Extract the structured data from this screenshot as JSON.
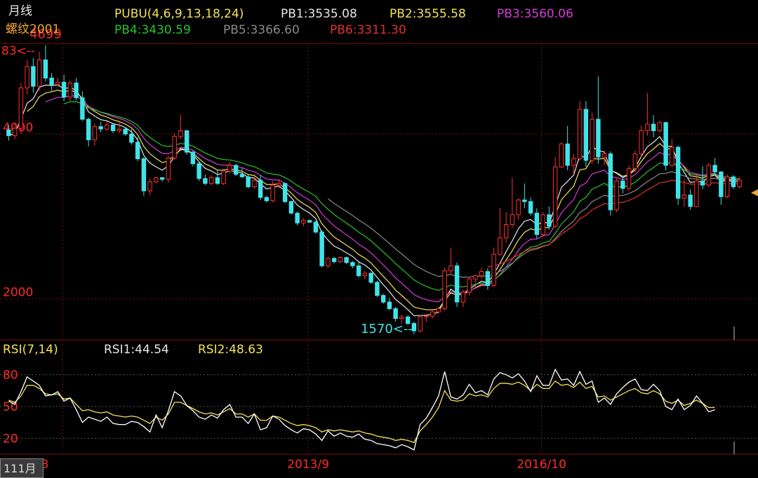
{
  "header": {
    "period": "月线",
    "symbol": "螺纹2001",
    "indicator": "PUBU(4,6,9,13,18,24)",
    "pb_values": [
      {
        "label": "PB1:3535.08",
        "color": "#e6e6e6"
      },
      {
        "label": "PB2:3555.58",
        "color": "#f3e15a"
      },
      {
        "label": "PB3:3560.06",
        "color": "#d63cd6"
      },
      {
        "label": "PB4:3430.59",
        "color": "#29c229"
      },
      {
        "label": "PB5:3366.60",
        "color": "#8a8a8a"
      },
      {
        "label": "PB6:3311.30",
        "color": "#e03030"
      }
    ]
  },
  "rsi_header": {
    "title": "RSI(7,14)",
    "rsi1": "RSI1:44.54",
    "rsi2": "RSI2:48.63"
  },
  "period_badge": "111月",
  "colors": {
    "up": "#ff3030",
    "down": "#41e3e8",
    "grid": "#7a1010",
    "axis_label": "#ff2a2a"
  },
  "chart_data": [
    {
      "type": "candlestick",
      "title": "螺纹2001 月线",
      "y_ticks": [
        "4000",
        "2000"
      ],
      "ylim": [
        1500,
        5100
      ],
      "annotations": {
        "high_label": "4699",
        "low_label": "1570<--",
        "left_label": "83<--"
      },
      "x_ticks": [
        "3",
        "2013/9",
        "2016/10"
      ],
      "candles": [
        {
          "o": 4050,
          "h": 4110,
          "l": 3920,
          "c": 3980
        },
        {
          "o": 3980,
          "h": 4130,
          "l": 3940,
          "c": 4070
        },
        {
          "o": 4070,
          "h": 4620,
          "l": 4000,
          "c": 4560
        },
        {
          "o": 4560,
          "h": 4900,
          "l": 4480,
          "c": 4820
        },
        {
          "o": 4820,
          "h": 4920,
          "l": 4500,
          "c": 4580
        },
        {
          "o": 4580,
          "h": 5000,
          "l": 4520,
          "c": 4900
        },
        {
          "o": 4900,
          "h": 5080,
          "l": 4640,
          "c": 4680
        },
        {
          "o": 4680,
          "h": 4740,
          "l": 4520,
          "c": 4600
        },
        {
          "o": 4600,
          "h": 4680,
          "l": 4580,
          "c": 4630
        },
        {
          "o": 4630,
          "h": 4720,
          "l": 4400,
          "c": 4450
        },
        {
          "o": 4450,
          "h": 4650,
          "l": 4400,
          "c": 4620
        },
        {
          "o": 4620,
          "h": 4680,
          "l": 4410,
          "c": 4440
        },
        {
          "o": 4440,
          "h": 4520,
          "l": 4160,
          "c": 4180
        },
        {
          "o": 4180,
          "h": 4200,
          "l": 3850,
          "c": 3930
        },
        {
          "o": 3930,
          "h": 4130,
          "l": 3860,
          "c": 4090
        },
        {
          "o": 4090,
          "h": 4150,
          "l": 4020,
          "c": 4060
        },
        {
          "o": 4060,
          "h": 4150,
          "l": 4040,
          "c": 4110
        },
        {
          "o": 4110,
          "h": 4120,
          "l": 4010,
          "c": 4040
        },
        {
          "o": 4040,
          "h": 4140,
          "l": 4010,
          "c": 4060
        },
        {
          "o": 4060,
          "h": 4080,
          "l": 3980,
          "c": 4000
        },
        {
          "o": 4000,
          "h": 4060,
          "l": 3870,
          "c": 3900
        },
        {
          "o": 3900,
          "h": 3960,
          "l": 3670,
          "c": 3700
        },
        {
          "o": 3700,
          "h": 3720,
          "l": 3250,
          "c": 3310
        },
        {
          "o": 3310,
          "h": 3460,
          "l": 3260,
          "c": 3420
        },
        {
          "o": 3420,
          "h": 3480,
          "l": 3400,
          "c": 3470
        },
        {
          "o": 3470,
          "h": 3480,
          "l": 3420,
          "c": 3450
        },
        {
          "o": 3450,
          "h": 3730,
          "l": 3410,
          "c": 3710
        },
        {
          "o": 3710,
          "h": 4010,
          "l": 3690,
          "c": 3970
        },
        {
          "o": 3970,
          "h": 4230,
          "l": 3940,
          "c": 4040
        },
        {
          "o": 4040,
          "h": 4050,
          "l": 3750,
          "c": 3780
        },
        {
          "o": 3780,
          "h": 3800,
          "l": 3610,
          "c": 3640
        },
        {
          "o": 3640,
          "h": 3660,
          "l": 3430,
          "c": 3460
        },
        {
          "o": 3460,
          "h": 3510,
          "l": 3380,
          "c": 3400
        },
        {
          "o": 3400,
          "h": 3500,
          "l": 3380,
          "c": 3470
        },
        {
          "o": 3470,
          "h": 3560,
          "l": 3380,
          "c": 3400
        },
        {
          "o": 3400,
          "h": 3580,
          "l": 3380,
          "c": 3550
        },
        {
          "o": 3550,
          "h": 3660,
          "l": 3520,
          "c": 3620
        },
        {
          "o": 3620,
          "h": 3640,
          "l": 3490,
          "c": 3510
        },
        {
          "o": 3510,
          "h": 3590,
          "l": 3470,
          "c": 3480
        },
        {
          "o": 3480,
          "h": 3500,
          "l": 3340,
          "c": 3360
        },
        {
          "o": 3360,
          "h": 3480,
          "l": 3340,
          "c": 3440
        },
        {
          "o": 3440,
          "h": 3500,
          "l": 3200,
          "c": 3230
        },
        {
          "o": 3230,
          "h": 3250,
          "l": 3170,
          "c": 3190
        },
        {
          "o": 3190,
          "h": 3430,
          "l": 3170,
          "c": 3380
        },
        {
          "o": 3380,
          "h": 3450,
          "l": 3340,
          "c": 3400
        },
        {
          "o": 3400,
          "h": 3410,
          "l": 3160,
          "c": 3180
        },
        {
          "o": 3180,
          "h": 3190,
          "l": 3020,
          "c": 3040
        },
        {
          "o": 3040,
          "h": 3060,
          "l": 2890,
          "c": 2920
        },
        {
          "o": 2920,
          "h": 2980,
          "l": 2880,
          "c": 2950
        },
        {
          "o": 2950,
          "h": 2960,
          "l": 2920,
          "c": 2930
        },
        {
          "o": 2930,
          "h": 2950,
          "l": 2790,
          "c": 2810
        },
        {
          "o": 2810,
          "h": 2830,
          "l": 2380,
          "c": 2400
        },
        {
          "o": 2400,
          "h": 2510,
          "l": 2380,
          "c": 2490
        },
        {
          "o": 2490,
          "h": 2510,
          "l": 2430,
          "c": 2450
        },
        {
          "o": 2450,
          "h": 2520,
          "l": 2430,
          "c": 2500
        },
        {
          "o": 2500,
          "h": 2510,
          "l": 2420,
          "c": 2440
        },
        {
          "o": 2440,
          "h": 2460,
          "l": 2370,
          "c": 2400
        },
        {
          "o": 2400,
          "h": 2460,
          "l": 2260,
          "c": 2280
        },
        {
          "o": 2280,
          "h": 2340,
          "l": 2240,
          "c": 2310
        },
        {
          "o": 2310,
          "h": 2320,
          "l": 2180,
          "c": 2200
        },
        {
          "o": 2200,
          "h": 2220,
          "l": 2020,
          "c": 2040
        },
        {
          "o": 2040,
          "h": 2060,
          "l": 1940,
          "c": 1960
        },
        {
          "o": 1960,
          "h": 2010,
          "l": 1860,
          "c": 1880
        },
        {
          "o": 1880,
          "h": 1900,
          "l": 1720,
          "c": 1760
        },
        {
          "o": 1760,
          "h": 1810,
          "l": 1700,
          "c": 1780
        },
        {
          "o": 1780,
          "h": 1800,
          "l": 1680,
          "c": 1700
        },
        {
          "o": 1700,
          "h": 1720,
          "l": 1570,
          "c": 1610
        },
        {
          "o": 1610,
          "h": 1800,
          "l": 1590,
          "c": 1780
        },
        {
          "o": 1780,
          "h": 1820,
          "l": 1720,
          "c": 1790
        },
        {
          "o": 1790,
          "h": 1880,
          "l": 1760,
          "c": 1840
        },
        {
          "o": 1840,
          "h": 1900,
          "l": 1820,
          "c": 1880
        },
        {
          "o": 1880,
          "h": 2380,
          "l": 1860,
          "c": 2340
        },
        {
          "o": 2340,
          "h": 2620,
          "l": 2290,
          "c": 2400
        },
        {
          "o": 2400,
          "h": 2440,
          "l": 1900,
          "c": 1960
        },
        {
          "o": 1960,
          "h": 2110,
          "l": 1900,
          "c": 2080
        },
        {
          "o": 2080,
          "h": 2260,
          "l": 2040,
          "c": 2240
        },
        {
          "o": 2240,
          "h": 2290,
          "l": 2140,
          "c": 2280
        },
        {
          "o": 2280,
          "h": 2380,
          "l": 2240,
          "c": 2330
        },
        {
          "o": 2330,
          "h": 2370,
          "l": 2110,
          "c": 2160
        },
        {
          "o": 2160,
          "h": 2620,
          "l": 2140,
          "c": 2540
        },
        {
          "o": 2540,
          "h": 3100,
          "l": 2520,
          "c": 2740
        },
        {
          "o": 2740,
          "h": 3050,
          "l": 2680,
          "c": 2900
        },
        {
          "o": 2900,
          "h": 3470,
          "l": 2860,
          "c": 3020
        },
        {
          "o": 3020,
          "h": 3220,
          "l": 2960,
          "c": 3200
        },
        {
          "o": 3200,
          "h": 3400,
          "l": 3100,
          "c": 3180
        },
        {
          "o": 3180,
          "h": 3230,
          "l": 3010,
          "c": 3040
        },
        {
          "o": 3040,
          "h": 3100,
          "l": 2730,
          "c": 2780
        },
        {
          "o": 2780,
          "h": 3050,
          "l": 2750,
          "c": 3020
        },
        {
          "o": 3020,
          "h": 3120,
          "l": 2840,
          "c": 2880
        },
        {
          "o": 2880,
          "h": 3720,
          "l": 2860,
          "c": 3600
        },
        {
          "o": 3600,
          "h": 3900,
          "l": 3590,
          "c": 3880
        },
        {
          "o": 3880,
          "h": 4100,
          "l": 3560,
          "c": 3620
        },
        {
          "o": 3620,
          "h": 3760,
          "l": 3510,
          "c": 3700
        },
        {
          "o": 3700,
          "h": 4400,
          "l": 3680,
          "c": 4300
        },
        {
          "o": 4300,
          "h": 4400,
          "l": 3600,
          "c": 3680
        },
        {
          "o": 3680,
          "h": 4260,
          "l": 3640,
          "c": 4180
        },
        {
          "o": 4180,
          "h": 4699,
          "l": 3640,
          "c": 3720
        },
        {
          "o": 3720,
          "h": 3800,
          "l": 3620,
          "c": 3760
        },
        {
          "o": 3760,
          "h": 3790,
          "l": 3010,
          "c": 3080
        },
        {
          "o": 3080,
          "h": 3460,
          "l": 3050,
          "c": 3430
        },
        {
          "o": 3430,
          "h": 3490,
          "l": 3280,
          "c": 3340
        },
        {
          "o": 3340,
          "h": 3620,
          "l": 3310,
          "c": 3580
        },
        {
          "o": 3580,
          "h": 3800,
          "l": 3540,
          "c": 3760
        },
        {
          "o": 3760,
          "h": 4100,
          "l": 3720,
          "c": 4040
        },
        {
          "o": 4040,
          "h": 4500,
          "l": 3980,
          "c": 4120
        },
        {
          "o": 4120,
          "h": 4230,
          "l": 3960,
          "c": 4040
        },
        {
          "o": 4040,
          "h": 4160,
          "l": 4020,
          "c": 4140
        },
        {
          "o": 4140,
          "h": 4150,
          "l": 3560,
          "c": 3620
        },
        {
          "o": 3620,
          "h": 3940,
          "l": 3600,
          "c": 3840
        },
        {
          "o": 3840,
          "h": 3860,
          "l": 3140,
          "c": 3220
        },
        {
          "o": 3220,
          "h": 3450,
          "l": 3120,
          "c": 3260
        },
        {
          "o": 3260,
          "h": 3330,
          "l": 3080,
          "c": 3120
        },
        {
          "o": 3120,
          "h": 3520,
          "l": 3110,
          "c": 3430
        },
        {
          "o": 3430,
          "h": 3610,
          "l": 3330,
          "c": 3380
        },
        {
          "o": 3380,
          "h": 3650,
          "l": 3360,
          "c": 3620
        },
        {
          "o": 3620,
          "h": 3710,
          "l": 3500,
          "c": 3540
        },
        {
          "o": 3540,
          "h": 3550,
          "l": 3140,
          "c": 3240
        },
        {
          "o": 3240,
          "h": 3510,
          "l": 3220,
          "c": 3480
        },
        {
          "o": 3480,
          "h": 3500,
          "l": 3330,
          "c": 3360
        },
        {
          "o": 3360,
          "h": 3480,
          "l": 3340,
          "c": 3440
        }
      ]
    },
    {
      "type": "line",
      "title": "RSI(7,14)",
      "y_ticks": [
        "80",
        "50",
        "20"
      ],
      "ylim": [
        5,
        95
      ],
      "series": [
        {
          "name": "RSI1",
          "color": "#ffffff",
          "values": [
            55,
            52,
            64,
            78,
            74,
            70,
            60,
            61,
            64,
            55,
            58,
            47,
            35,
            40,
            38,
            36,
            40,
            34,
            33,
            33,
            36,
            35,
            31,
            26,
            42,
            30,
            46,
            64,
            60,
            51,
            46,
            40,
            38,
            42,
            39,
            47,
            52,
            40,
            40,
            34,
            43,
            28,
            30,
            41,
            38,
            32,
            28,
            25,
            29,
            28,
            24,
            18,
            27,
            22,
            25,
            22,
            21,
            24,
            19,
            18,
            15,
            14,
            13,
            11,
            14,
            12,
            9,
            33,
            39,
            49,
            60,
            83,
            59,
            57,
            61,
            71,
            63,
            65,
            61,
            76,
            82,
            80,
            77,
            81,
            74,
            64,
            79,
            70,
            70,
            85,
            75,
            76,
            70,
            83,
            71,
            74,
            54,
            58,
            52,
            62,
            68,
            73,
            76,
            66,
            65,
            71,
            65,
            50,
            47,
            57,
            47,
            51,
            60,
            53,
            45,
            47
          ]
        },
        {
          "name": "RSI2",
          "color": "#f3e15a",
          "values": [
            56,
            54,
            60,
            70,
            70,
            67,
            62,
            61,
            62,
            57,
            58,
            52,
            46,
            47,
            45,
            44,
            45,
            42,
            41,
            40,
            41,
            40,
            37,
            34,
            40,
            37,
            43,
            54,
            54,
            51,
            48,
            45,
            43,
            44,
            42,
            45,
            48,
            43,
            43,
            40,
            43,
            37,
            37,
            41,
            40,
            37,
            34,
            32,
            33,
            32,
            30,
            26,
            28,
            27,
            28,
            27,
            26,
            27,
            25,
            24,
            22,
            21,
            20,
            18,
            19,
            18,
            16,
            27,
            33,
            40,
            49,
            65,
            56,
            55,
            56,
            62,
            60,
            61,
            59,
            67,
            72,
            72,
            71,
            73,
            70,
            65,
            71,
            67,
            67,
            74,
            70,
            71,
            68,
            73,
            67,
            69,
            59,
            60,
            56,
            59,
            62,
            65,
            67,
            63,
            62,
            65,
            62,
            55,
            53,
            56,
            51,
            53,
            56,
            53,
            49,
            49
          ]
        }
      ]
    }
  ]
}
